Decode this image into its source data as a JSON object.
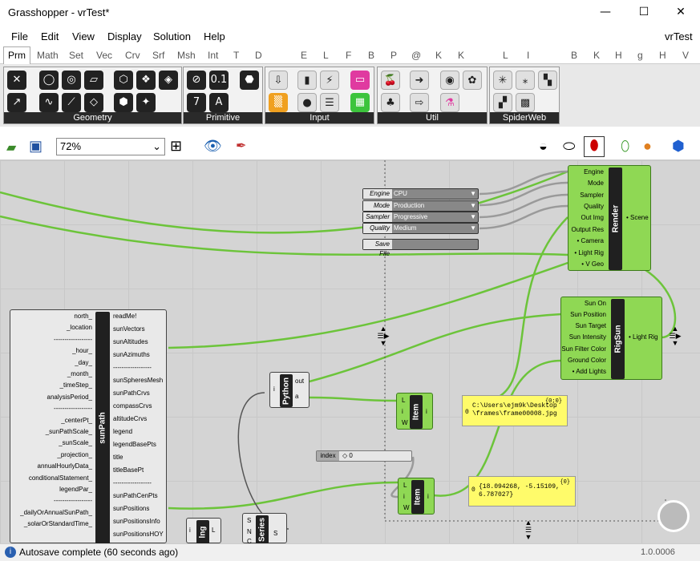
{
  "window": {
    "title": "Grasshopper - vrTest*",
    "minimize": "—",
    "maximize": "☐",
    "close": "✕"
  },
  "menu": {
    "items": [
      "File",
      "Edit",
      "View",
      "Display",
      "Solution",
      "Help"
    ],
    "doc": "vrTest"
  },
  "tabs": [
    "Prm",
    "Math",
    "Set",
    "Vec",
    "Crv",
    "Srf",
    "Msh",
    "Int",
    "T",
    "D",
    "E",
    "L",
    "F",
    "B",
    "P",
    "@",
    "K",
    "K",
    "L",
    "I",
    "B",
    "K",
    "H",
    "g",
    "H",
    "V"
  ],
  "ribbon": {
    "panels": [
      "Geometry",
      "Primitive",
      "Input",
      "Util",
      "SpiderWeb"
    ]
  },
  "toolbar": {
    "zoom": "72%"
  },
  "render": {
    "title": "Render",
    "inputs": [
      "Engine",
      "Mode",
      "Sampler",
      "Quality",
      "Out Img",
      "Output Res",
      "• Camera",
      "• Light Rig",
      "• V Geo"
    ],
    "output": "• Scene"
  },
  "settings": [
    {
      "label": "Engine",
      "value": "CPU"
    },
    {
      "label": "Mode",
      "value": "Production"
    },
    {
      "label": "Sampler",
      "value": "Progressive"
    },
    {
      "label": "Quality",
      "value": "Medium"
    },
    {
      "label": "Save File",
      "value": ""
    }
  ],
  "rigsun": {
    "title": "RigSun",
    "inputs": [
      "Sun On",
      "Sun Position",
      "Sun Target",
      "Sun Intensity",
      "Sun Filter Color",
      "Ground Color",
      "• Add Lights"
    ],
    "output": "• Light Rig"
  },
  "sunpath": {
    "title": "sunPath",
    "inputs": [
      "north_",
      "_location",
      "------------------",
      "_hour_",
      "_day_",
      "_month_",
      "_timeStep_",
      "analysisPeriod_",
      "------------------",
      "_centerPt_",
      "_sunPathScale_",
      "_sunScale_",
      "_projection_",
      "annualHourlyData_",
      "conditionalStatement_",
      "legendPar_",
      "------------------",
      "_dailyOrAnnualSunPath_",
      "_solarOrStandardTime_"
    ],
    "outputs": [
      "readMe!",
      "sunVectors",
      "sunAltitudes",
      "sunAzimuths",
      "------------------",
      "sunSpheresMesh",
      "sunPathCrvs",
      "compassCrvs",
      "altitudeCrvs",
      "legend",
      "legendBasePts",
      "title",
      "titleBasePt",
      "------------------",
      "sunPathCenPts",
      "sunPositions",
      "sunPositionsInfo",
      "sunPositionsHOY"
    ]
  },
  "python": {
    "title": "Python",
    "in": "i",
    "outs": [
      "out",
      "a"
    ]
  },
  "item1": {
    "title": "Item",
    "inputs": [
      "L",
      "i",
      "W"
    ],
    "output": "i"
  },
  "item2": {
    "title": "Item",
    "inputs": [
      "L",
      "i",
      "W"
    ],
    "output": "i"
  },
  "panel1": {
    "header": "{0;0}",
    "index": "0",
    "text": "C:\\Users\\ejm9k\\Desktop\\frames\\frame00008.jpg"
  },
  "panel2": {
    "header": "{0}",
    "index": "0",
    "text": "{18.094268, -5.15109, 6.787027}"
  },
  "slider": {
    "label": "index",
    "value": "◇ 0"
  },
  "lng": {
    "title": "lng",
    "in": "i",
    "out": "L"
  },
  "series": {
    "title": "Series",
    "inputs": [
      "S",
      "N",
      "C"
    ],
    "out": "S"
  },
  "status": {
    "message": "Autosave complete (60 seconds ago)",
    "version": "1.0.0006"
  },
  "colors": {
    "component_green": "#8fd854",
    "wire_green": "#6cc43a",
    "canvas": "#d4d4d4",
    "panel_yellow": "#fffb6a"
  }
}
